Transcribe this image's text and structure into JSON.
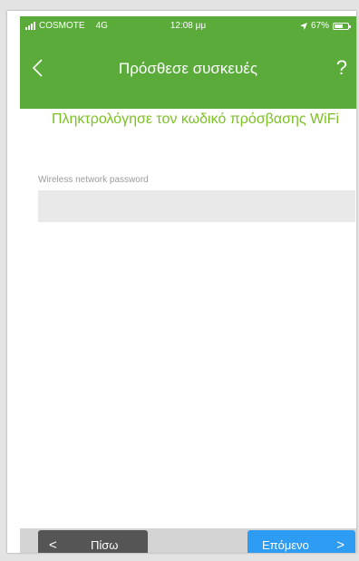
{
  "status_bar": {
    "carrier": "COSMOTE",
    "network": "4G",
    "time": "12:08 μμ",
    "location_icon": "location-arrow-icon",
    "battery_text": "67%",
    "battery_level": 0.67
  },
  "nav": {
    "back_icon": "chevron-left-icon",
    "title": "Πρόσθεσε συσκευές",
    "help_label": "?"
  },
  "main": {
    "heading": "Πληκτρολόγησε τον κωδικό πρόσβασης WiFi",
    "field_label": "Wireless network password",
    "password_value": ""
  },
  "footer": {
    "back_chevron": "<",
    "back_label": "Πίσω",
    "next_label": "Επόμενο",
    "next_chevron": ">"
  },
  "colors": {
    "header_green": "#5aab3a",
    "heading_green": "#7cc025",
    "back_button": "#555555",
    "next_button": "#2f9cf3",
    "input_background": "#e9e9e9",
    "footer_background": "#d4d4d4"
  }
}
